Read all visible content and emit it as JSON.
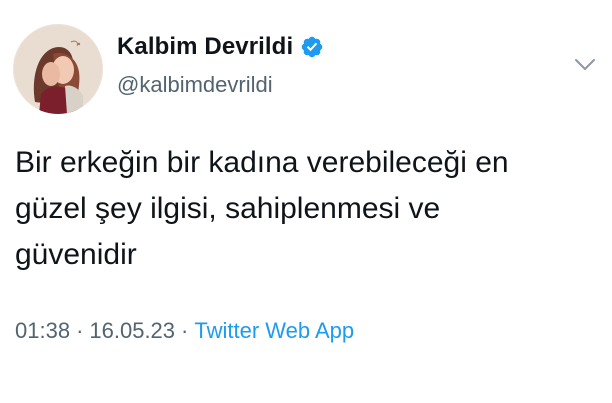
{
  "author": {
    "display_name": "Kalbim Devrildi",
    "handle": "@kalbimdevrildi",
    "verified": true,
    "verified_color": "#1d9bf0"
  },
  "tweet": {
    "text": "Bir erkeğin bir kadına verebileceği en\ngüzel şey ilgisi, sahiplenmesi ve\ngüvenidir",
    "time": "01:38",
    "separator": "·",
    "date": "16.05.23",
    "source": "Twitter Web App"
  },
  "colors": {
    "text_primary": "#0f1419",
    "text_secondary": "#536471",
    "link": "#1d9bf0"
  },
  "icons": {
    "more": "chevron-down-icon",
    "verified": "verified-badge-icon"
  }
}
